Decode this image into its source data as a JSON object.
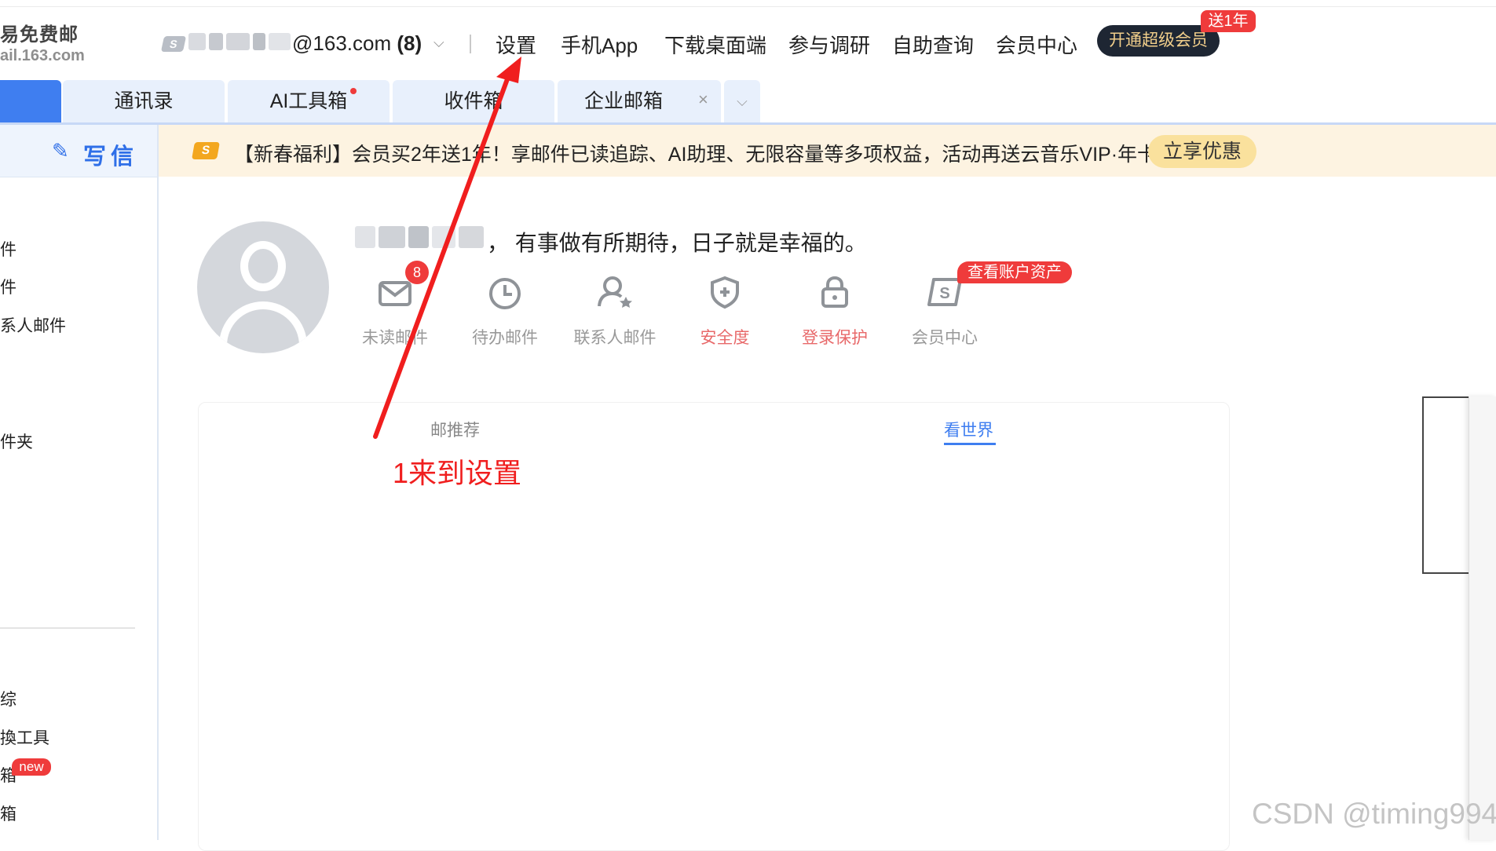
{
  "header": {
    "logo_cn": "易免费邮",
    "logo_domain": "ail.163.com",
    "account_icon": "S",
    "account_suffix": "@163.com",
    "account_count": "(8)",
    "nav": [
      "设置",
      "手机App",
      "下载桌面端",
      "参与调研",
      "自助查询",
      "会员中心"
    ],
    "vip_button": "开通超级会员",
    "vip_badge": "送1年"
  },
  "tabs": [
    {
      "label": "通讯录"
    },
    {
      "label": "AI工具箱"
    },
    {
      "label": "收件箱"
    },
    {
      "label": "企业邮箱"
    }
  ],
  "tab_close": "×",
  "tab_more": "⌵",
  "sidebar": {
    "compose_label": "写信",
    "items": [
      "件",
      "件",
      "系人邮件",
      "件夹",
      "综",
      "換工具",
      "箱",
      "箱"
    ],
    "new_badge": "new"
  },
  "promo": {
    "icon": "S",
    "text": "【新春福利】会员买2年送1年！享邮件已读追踪、AI助理、无限容量等多项权益，活动再送云音乐VIP·年卡",
    "button": "立享优惠"
  },
  "profile": {
    "greeting": "，  有事做有所期待，日子就是幸福的。",
    "unread_count": "8",
    "asset_badge": "查看账户资产",
    "quick_actions": [
      {
        "label": "未读邮件",
        "icon": "envelope-icon",
        "color": "#999999"
      },
      {
        "label": "待办邮件",
        "icon": "clock-icon",
        "color": "#999999"
      },
      {
        "label": "联系人邮件",
        "icon": "contact-star-icon",
        "color": "#999999"
      },
      {
        "label": "安全度",
        "icon": "shield-icon",
        "color": "#e8696a"
      },
      {
        "label": "登录保护",
        "icon": "lock-icon",
        "color": "#e8696a"
      },
      {
        "label": "会员中心",
        "icon": "vip-s-icon",
        "color": "#999999"
      }
    ]
  },
  "feed": {
    "tabs": [
      "邮推荐",
      "看世界"
    ],
    "active_tab": "看世界"
  },
  "annotation": {
    "text": "1来到设置",
    "color": "#f01e1e"
  },
  "watermark": "CSDN @timing994",
  "colors": {
    "accent": "#3f7ef0",
    "badge_red": "#ef3b3b",
    "promo_bg": "#fdf3e1",
    "promo_button": "#fae19d",
    "vip_dark": "#1e2633",
    "vip_gold": "#f2cf8b"
  }
}
